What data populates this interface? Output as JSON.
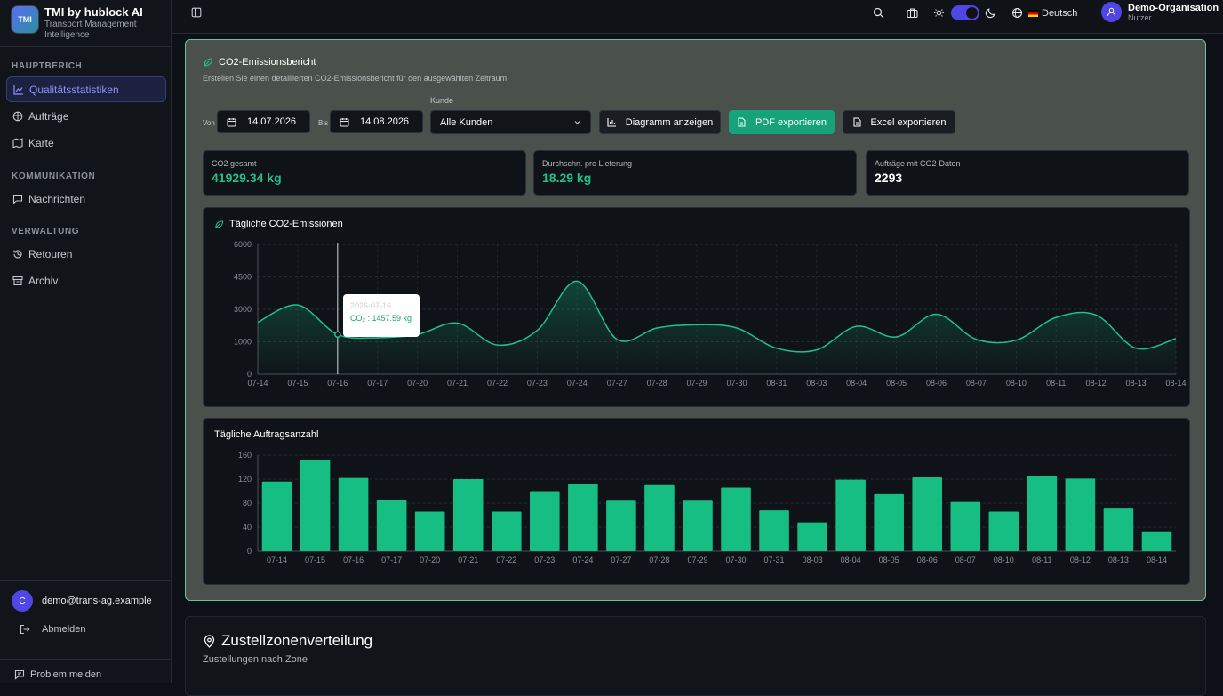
{
  "brand": {
    "logo": "TMI",
    "title": "TMI by hublock AI",
    "subtitle1": "Transport Management",
    "subtitle2": "Intelligence"
  },
  "sidebar": {
    "sections": [
      "HAUPTBERICH",
      "KOMMUNIKATION",
      "VERWALTUNG"
    ],
    "items": [
      {
        "label": "Qualitätsstatistiken",
        "icon": "chart-icon"
      },
      {
        "label": "Aufträge",
        "icon": "box-icon"
      },
      {
        "label": "Karte",
        "icon": "map-icon"
      },
      {
        "label": "Nachrichten",
        "icon": "message-icon"
      },
      {
        "label": "Retouren",
        "icon": "history-icon"
      },
      {
        "label": "Archiv",
        "icon": "archive-icon"
      }
    ],
    "user_avatar": "C",
    "user_email": "demo@trans-ag.example",
    "logout": "Abmelden",
    "report": "Problem melden"
  },
  "topbar": {
    "language": "Deutsch",
    "org_name": "Demo-Organisation",
    "org_role": "Nutzer",
    "theme_toggle": "on"
  },
  "report": {
    "title": "CO2-Emissionsbericht",
    "description": "Erstellen Sie einen detaillierten CO2-Emissionsbericht für den ausgewählten Zeitraum",
    "from_label": "Von",
    "from_date": "14.07.2026",
    "to_label": "Bis",
    "to_date": "14.08.2026",
    "customer_label": "Kunde",
    "customer_value": "Alle Kunden",
    "btn_chart": "Diagramm anzeigen",
    "btn_pdf": "PDF exportieren",
    "btn_excel": "Excel exportieren",
    "stats": [
      {
        "label": "CO2 gesamt",
        "value": "41929.34 kg",
        "color": "#22c08a"
      },
      {
        "label": "Durchschn. pro Lieferung",
        "value": "18.29 kg",
        "color": "#22c08a"
      },
      {
        "label": "Aufträge mit CO2-Daten",
        "value": "2293",
        "color": "#ffffff"
      }
    ],
    "tooltip": {
      "date": "2026-07-16",
      "label": "CO₂ : 1457.59 kg"
    }
  },
  "chart_data": [
    {
      "type": "area",
      "title": "Tägliche CO2-Emissionen",
      "x": [
        "07-14",
        "07-15",
        "07-16",
        "07-17",
        "07-20",
        "07-21",
        "07-22",
        "07-23",
        "07-24",
        "07-27",
        "07-28",
        "07-29",
        "07-30",
        "08-31",
        "08-03",
        "08-04",
        "08-05",
        "08-06",
        "08-07",
        "08-10",
        "08-11",
        "08-12",
        "08-13",
        "08-14"
      ],
      "y_ticks": [
        0,
        1000,
        3000,
        4500,
        6000
      ],
      "values": [
        2200,
        3200,
        1450,
        1250,
        1450,
        2150,
        900,
        1700,
        4300,
        1150,
        1850,
        2050,
        1850,
        800,
        750,
        1950,
        1300,
        2700,
        1150,
        1100,
        2500,
        2650,
        800,
        1200
      ],
      "grid": true
    },
    {
      "type": "bar",
      "title": "Tägliche Auftragsanzahl",
      "categories": [
        "07-14",
        "07-15",
        "07-16",
        "07-17",
        "07-20",
        "07-21",
        "07-22",
        "07-23",
        "07-24",
        "07-27",
        "07-28",
        "07-29",
        "07-30",
        "07-31",
        "08-03",
        "08-04",
        "08-05",
        "08-06",
        "08-07",
        "08-10",
        "08-11",
        "08-12",
        "08-13",
        "08-14"
      ],
      "y_ticks": [
        0,
        40,
        80,
        120,
        160
      ],
      "values": [
        116,
        152,
        122,
        86,
        66,
        120,
        66,
        100,
        112,
        84,
        110,
        84,
        106,
        68,
        48,
        119,
        95,
        123,
        82,
        66,
        126,
        121,
        71,
        33
      ],
      "grid": true
    }
  ],
  "zone": {
    "title": "Zustellzonenverteilung",
    "subtitle": "Zustellungen nach Zone"
  },
  "colors": {
    "accent": "#4f46e5",
    "green": "#16a37a"
  }
}
